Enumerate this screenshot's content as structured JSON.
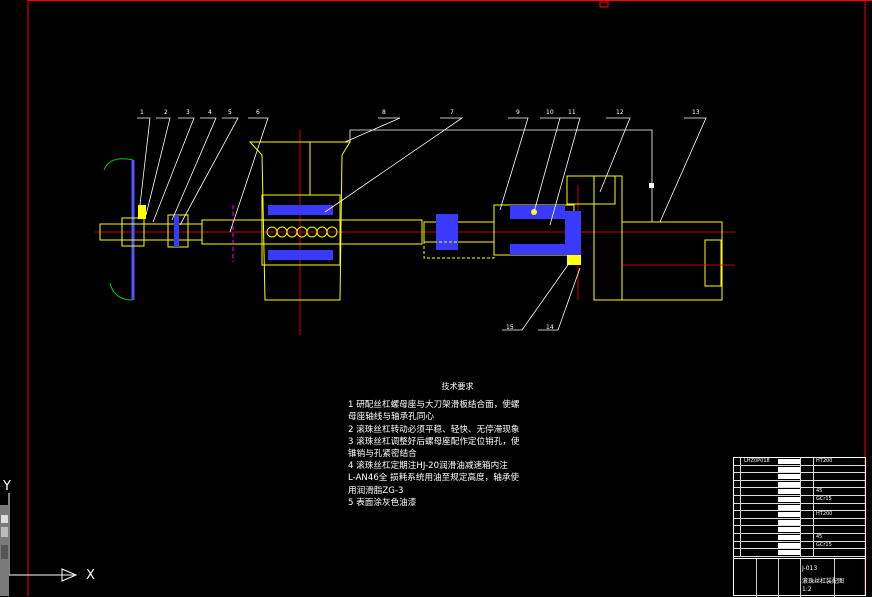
{
  "colors": {
    "background": "#000000",
    "border_red": "#ff0000",
    "outline_yellow": "#ffff00",
    "hatch_blue": "#3a3aff",
    "centerline_red": "#ff0000",
    "leader_white": "#ffffff",
    "ring_green": "#00cc00",
    "axis_magenta": "#ff00ff"
  },
  "part_numbers": [
    "1",
    "2",
    "3",
    "4",
    "5",
    "6",
    "8",
    "7",
    "9",
    "10",
    "11",
    "12",
    "13",
    "15",
    "14"
  ],
  "technical_requirements": {
    "title": "技术要求",
    "lines": [
      "1 研配丝杠螺母座与大刀架滑板结合面，使螺",
      "母座轴线与轴承孔同心",
      "2 滚珠丝杠转动必须平稳、轻快、无停滞现象",
      "3 滚珠丝杠调整好后螺母座配作定位销孔，使",
      "锥销与孔紧密结合",
      "4 滚珠丝杠定期注HJ-20润滑油减速箱内注",
      "L-AN46全    损耗系统用油至规定高度，轴承使",
      "用润滑脂ZG-3",
      "5 表面涂灰色油漆"
    ]
  },
  "title_block": {
    "rows": [
      {
        "left": "LHZ0P018",
        "right": "HT200"
      },
      {
        "left": "",
        "right": ""
      },
      {
        "left": "",
        "right": ""
      },
      {
        "left": "",
        "right": ""
      },
      {
        "left": "",
        "right": "45"
      },
      {
        "left": "",
        "right": "GCr15"
      },
      {
        "left": "",
        "right": ""
      },
      {
        "left": "",
        "right": "HT200"
      },
      {
        "left": "",
        "right": ""
      },
      {
        "left": "",
        "right": ""
      },
      {
        "left": "",
        "right": "45"
      },
      {
        "left": "",
        "right": "GCr15"
      },
      {
        "left": "",
        "right": ""
      }
    ],
    "drawing_code": "J-013",
    "drawing_name": "滚珠丝杠装配图",
    "footer": "1:2"
  },
  "ucs": {
    "x_label": "X",
    "y_label": "Y"
  }
}
